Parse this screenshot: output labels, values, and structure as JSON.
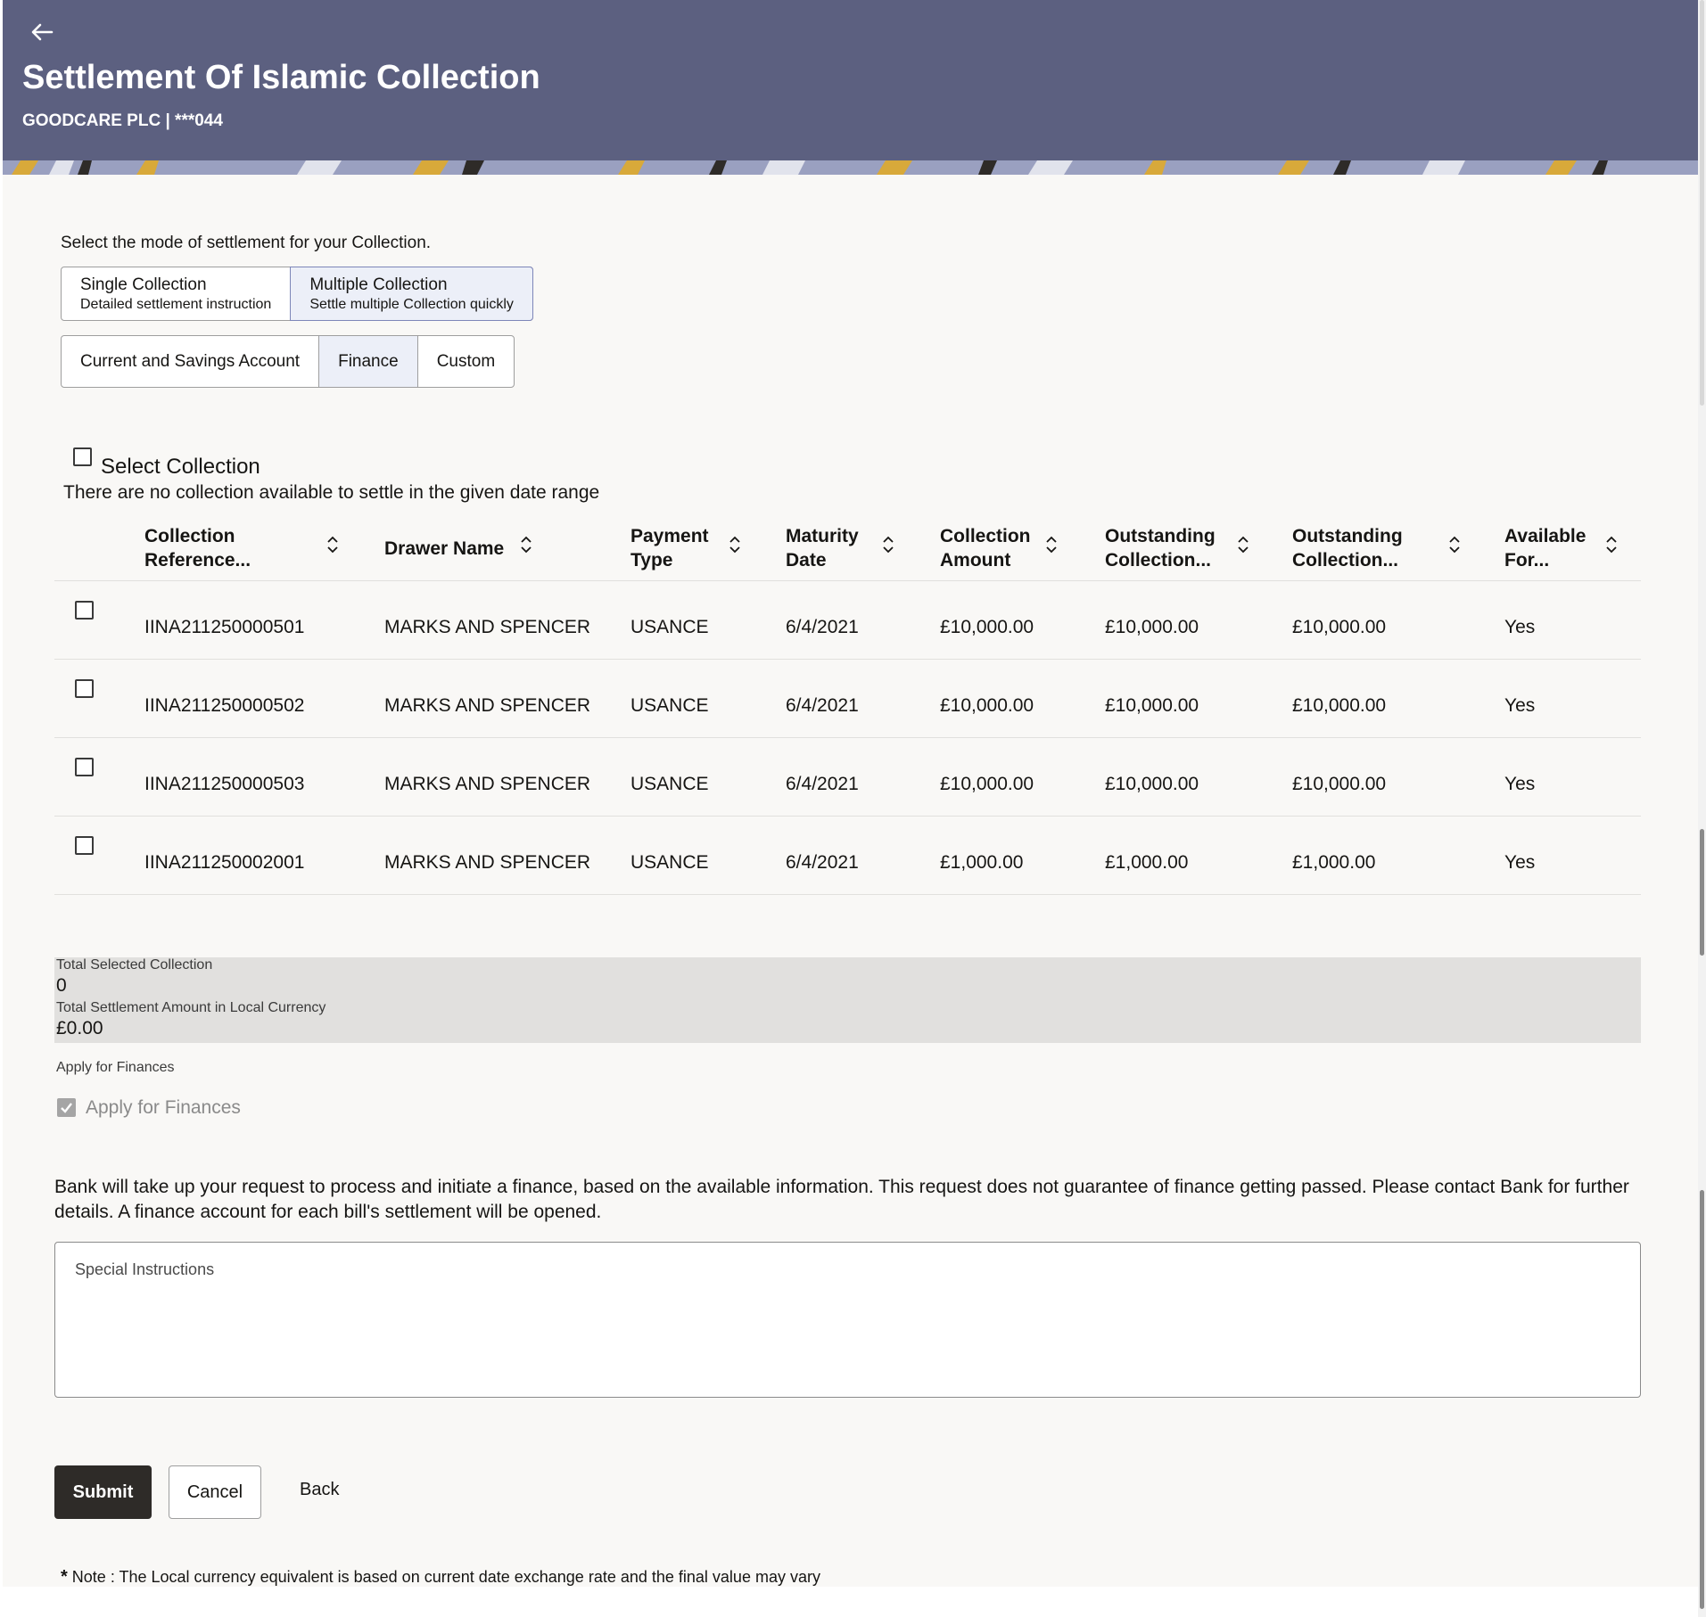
{
  "header": {
    "back_icon": "arrow-left-icon",
    "title": "Settlement Of Islamic Collection",
    "subtitle": "GOODCARE PLC | ***044"
  },
  "mode": {
    "label": "Select the mode of settlement for your Collection.",
    "options": [
      {
        "title": "Single Collection",
        "sub": "Detailed settlement instruction"
      },
      {
        "title": "Multiple Collection",
        "sub": "Settle multiple Collection quickly"
      }
    ],
    "selected": "Multiple Collection"
  },
  "account_types": {
    "options": [
      "Current and Savings Account",
      "Finance",
      "Custom"
    ],
    "selected": "Finance"
  },
  "select_collection": {
    "label": "Select Collection",
    "message": "There are no collection available to settle in the given date range"
  },
  "table": {
    "headers": [
      [
        "Collection",
        "Reference..."
      ],
      [
        "Drawer Name"
      ],
      [
        "Payment",
        "Type"
      ],
      [
        "Maturity",
        "Date"
      ],
      [
        "Collection",
        "Amount"
      ],
      [
        "Outstanding",
        "Collection..."
      ],
      [
        "Outstanding",
        "Collection..."
      ],
      [
        "Available",
        "For..."
      ]
    ],
    "rows": [
      [
        "IINA211250000501",
        "MARKS AND SPENCER",
        "USANCE",
        "6/4/2021",
        "£10,000.00",
        "£10,000.00",
        "£10,000.00",
        "Yes"
      ],
      [
        "IINA211250000502",
        "MARKS AND SPENCER",
        "USANCE",
        "6/4/2021",
        "£10,000.00",
        "£10,000.00",
        "£10,000.00",
        "Yes"
      ],
      [
        "IINA211250000503",
        "MARKS AND SPENCER",
        "USANCE",
        "6/4/2021",
        "£10,000.00",
        "£10,000.00",
        "£10,000.00",
        "Yes"
      ],
      [
        "IINA211250002001",
        "MARKS AND SPENCER",
        "USANCE",
        "6/4/2021",
        "£1,000.00",
        "£1,000.00",
        "£1,000.00",
        "Yes"
      ]
    ]
  },
  "totals": {
    "selected_label": "Total Selected Collection",
    "selected_value": "0",
    "amount_label": "Total Settlement Amount in Local Currency",
    "amount_value": "£0.00"
  },
  "finances": {
    "label": "Apply for Finances",
    "checkbox_label": "Apply for Finances",
    "checked": true
  },
  "info_text": "Bank will take up your request to process and initiate a finance, based on the available information. This request does not guarantee of finance getting passed. Please contact Bank for further details. A finance account for each bill's settlement will be opened.",
  "special_instructions": {
    "placeholder": "Special Instructions"
  },
  "actions": {
    "submit": "Submit",
    "cancel": "Cancel",
    "back": "Back"
  },
  "note": {
    "marker": "*",
    "text": " Note : The Local currency equivalent is based on current date exchange rate and the final value may vary"
  },
  "colors": {
    "header_bg": "#5c6080",
    "primary_button": "#2e2b28",
    "selected_segment": "#eceff8"
  }
}
